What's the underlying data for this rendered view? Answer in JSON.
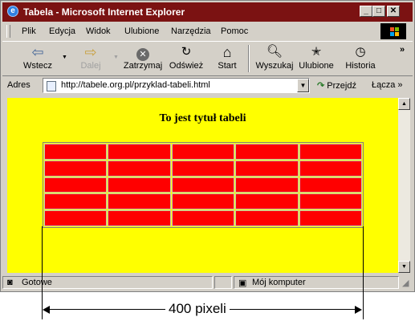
{
  "window": {
    "title": "Tabela - Microsoft Internet Explorer",
    "app_icon_glyph": "e",
    "buttons": {
      "minimize": "_",
      "maximize": "□",
      "close": "✕"
    }
  },
  "menu": {
    "items": [
      {
        "label": "Plik"
      },
      {
        "label": "Edycja"
      },
      {
        "label": "Widok"
      },
      {
        "label": "Ulubione"
      },
      {
        "label": "Narzędzia"
      },
      {
        "label": "Pomoc"
      }
    ]
  },
  "toolbar": {
    "back": {
      "label": "Wstecz",
      "icon": "left-arrow-icon"
    },
    "forward": {
      "label": "Dalej",
      "icon": "right-arrow-icon"
    },
    "stop": {
      "label": "Zatrzymaj",
      "icon": "stop-icon"
    },
    "refresh": {
      "label": "Odśwież",
      "icon": "refresh-icon"
    },
    "home": {
      "label": "Start",
      "icon": "home-icon"
    },
    "search": {
      "label": "Wyszukaj",
      "icon": "search-icon"
    },
    "favorites": {
      "label": "Ulubione",
      "icon": "favorites-icon"
    },
    "history": {
      "label": "Historia",
      "icon": "history-icon"
    },
    "overflow": "»"
  },
  "address": {
    "label": "Adres",
    "url": "http://tabele.org.pl/przyklad-tabeli.html",
    "go_label": "Przejdź",
    "links_label": "Łącza »"
  },
  "page": {
    "title": "To jest tytuł tabeli",
    "background_color": "#ffff00",
    "table": {
      "rows": 5,
      "cols": 5,
      "cell_color": "#ff0000"
    }
  },
  "status": {
    "text": "Gotowe",
    "zone": "Mój komputer"
  },
  "annotation": {
    "label": "400 pixeli"
  }
}
